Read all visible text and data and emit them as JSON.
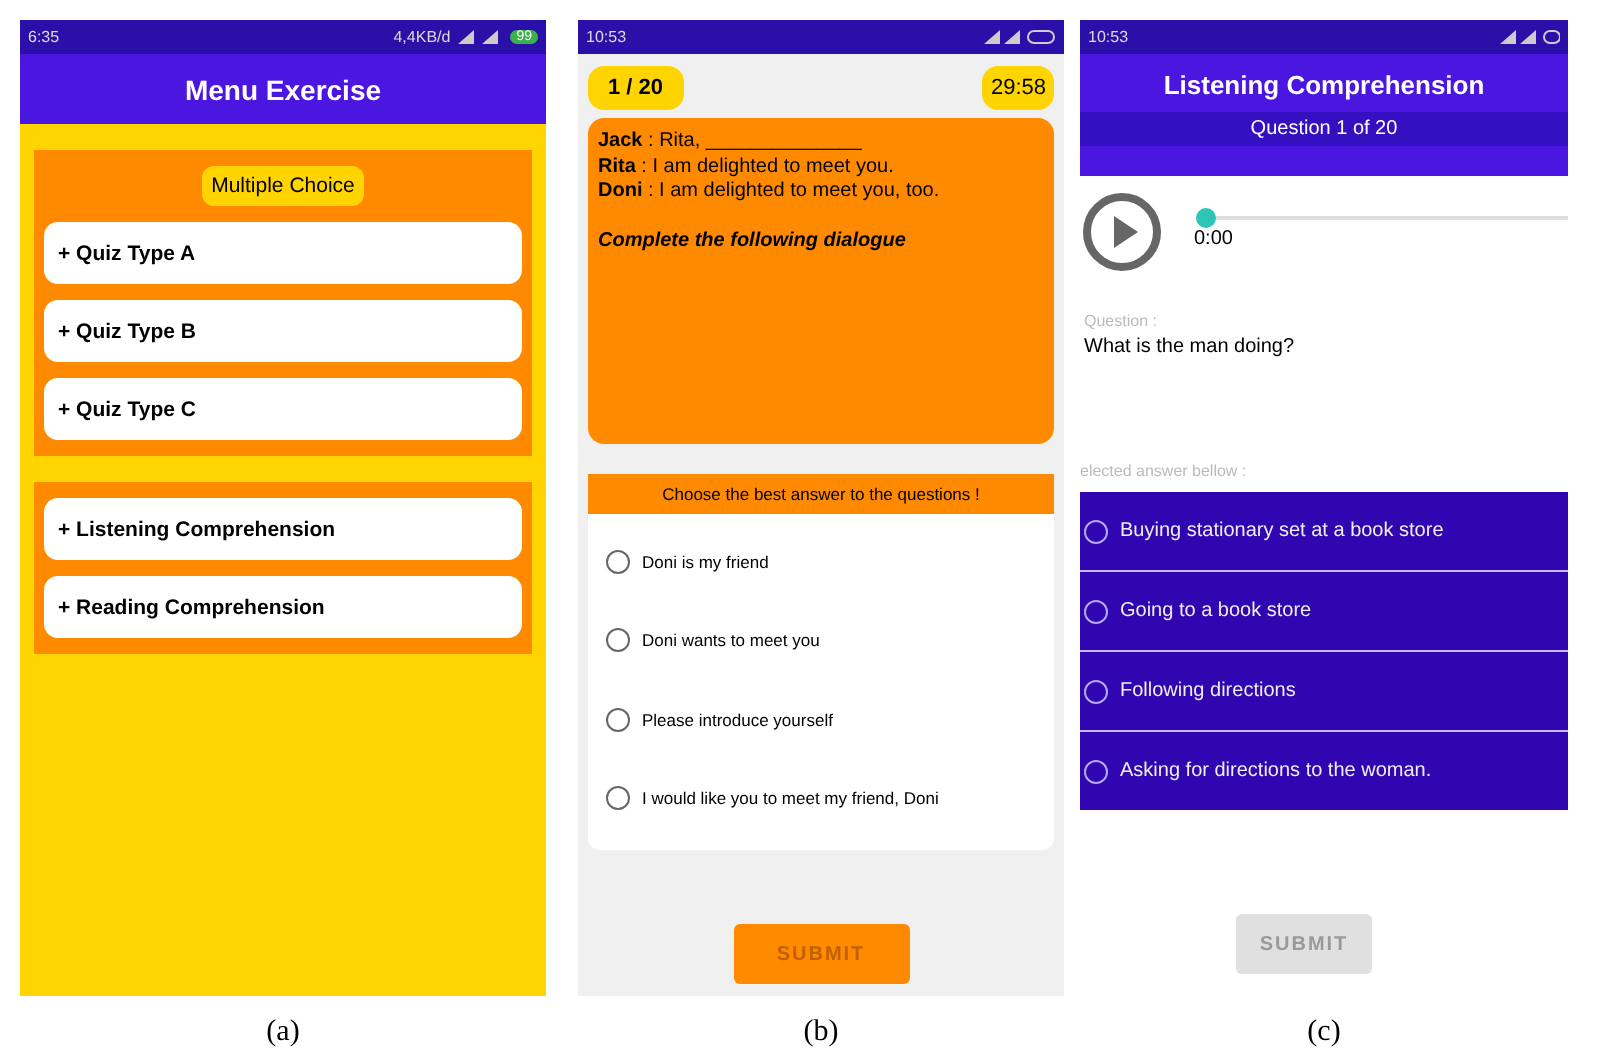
{
  "screens": [
    {
      "status_bar": {
        "time": "6:35",
        "network_speed": "4,4KB/d",
        "battery": "99"
      },
      "title": "Menu Exercise",
      "sections": [
        {
          "heading": "Multiple Choice",
          "items": [
            "+ Quiz Type A",
            "+ Quiz Type B",
            "+ Quiz Type C"
          ]
        },
        {
          "items": [
            "+ Listening Comprehension",
            "+ Reading Comprehension"
          ]
        }
      ],
      "caption": "(a)"
    },
    {
      "status_bar": {
        "time": "10:53"
      },
      "counter": "1 / 20",
      "timer": "29:58",
      "dialogue": [
        "**Jack** : Rita, ______________",
        "**Rita** : I am delighted to meet you.",
        "**Doni** : I am delighted to meet you, too."
      ],
      "instruction": "Complete the following dialogue",
      "prompt": "Choose the best answer to the questions !",
      "options": [
        {
          "label": "Doni is my friend",
          "selected": false
        },
        {
          "label": "Doni wants to meet you",
          "selected": false
        },
        {
          "label": "Please introduce yourself",
          "selected": false
        },
        {
          "label": "I would like you to meet my friend, Doni",
          "selected": false
        }
      ],
      "submit": {
        "label": "SUBMIT",
        "disabled": false
      },
      "caption": "(b)"
    },
    {
      "status_bar": {
        "time": "10:53"
      },
      "title": "Listening Comprehension",
      "subtitle": "Question 1 of 20",
      "player": {
        "level": 0,
        "time": "0:00"
      },
      "question_label": "Question :",
      "question": "What is the man doing?",
      "answer_label": "elected answer bellow :",
      "options": [
        {
          "label": "Buying stationary set at a book store",
          "selected": false
        },
        {
          "label": "Going to a book store",
          "selected": false
        },
        {
          "label": "Following directions",
          "selected": false
        },
        {
          "label": "Asking for directions to the woman.",
          "selected": false
        }
      ],
      "submit": {
        "label": "SUBMIT",
        "disabled": true
      },
      "caption": "(c)"
    }
  ]
}
